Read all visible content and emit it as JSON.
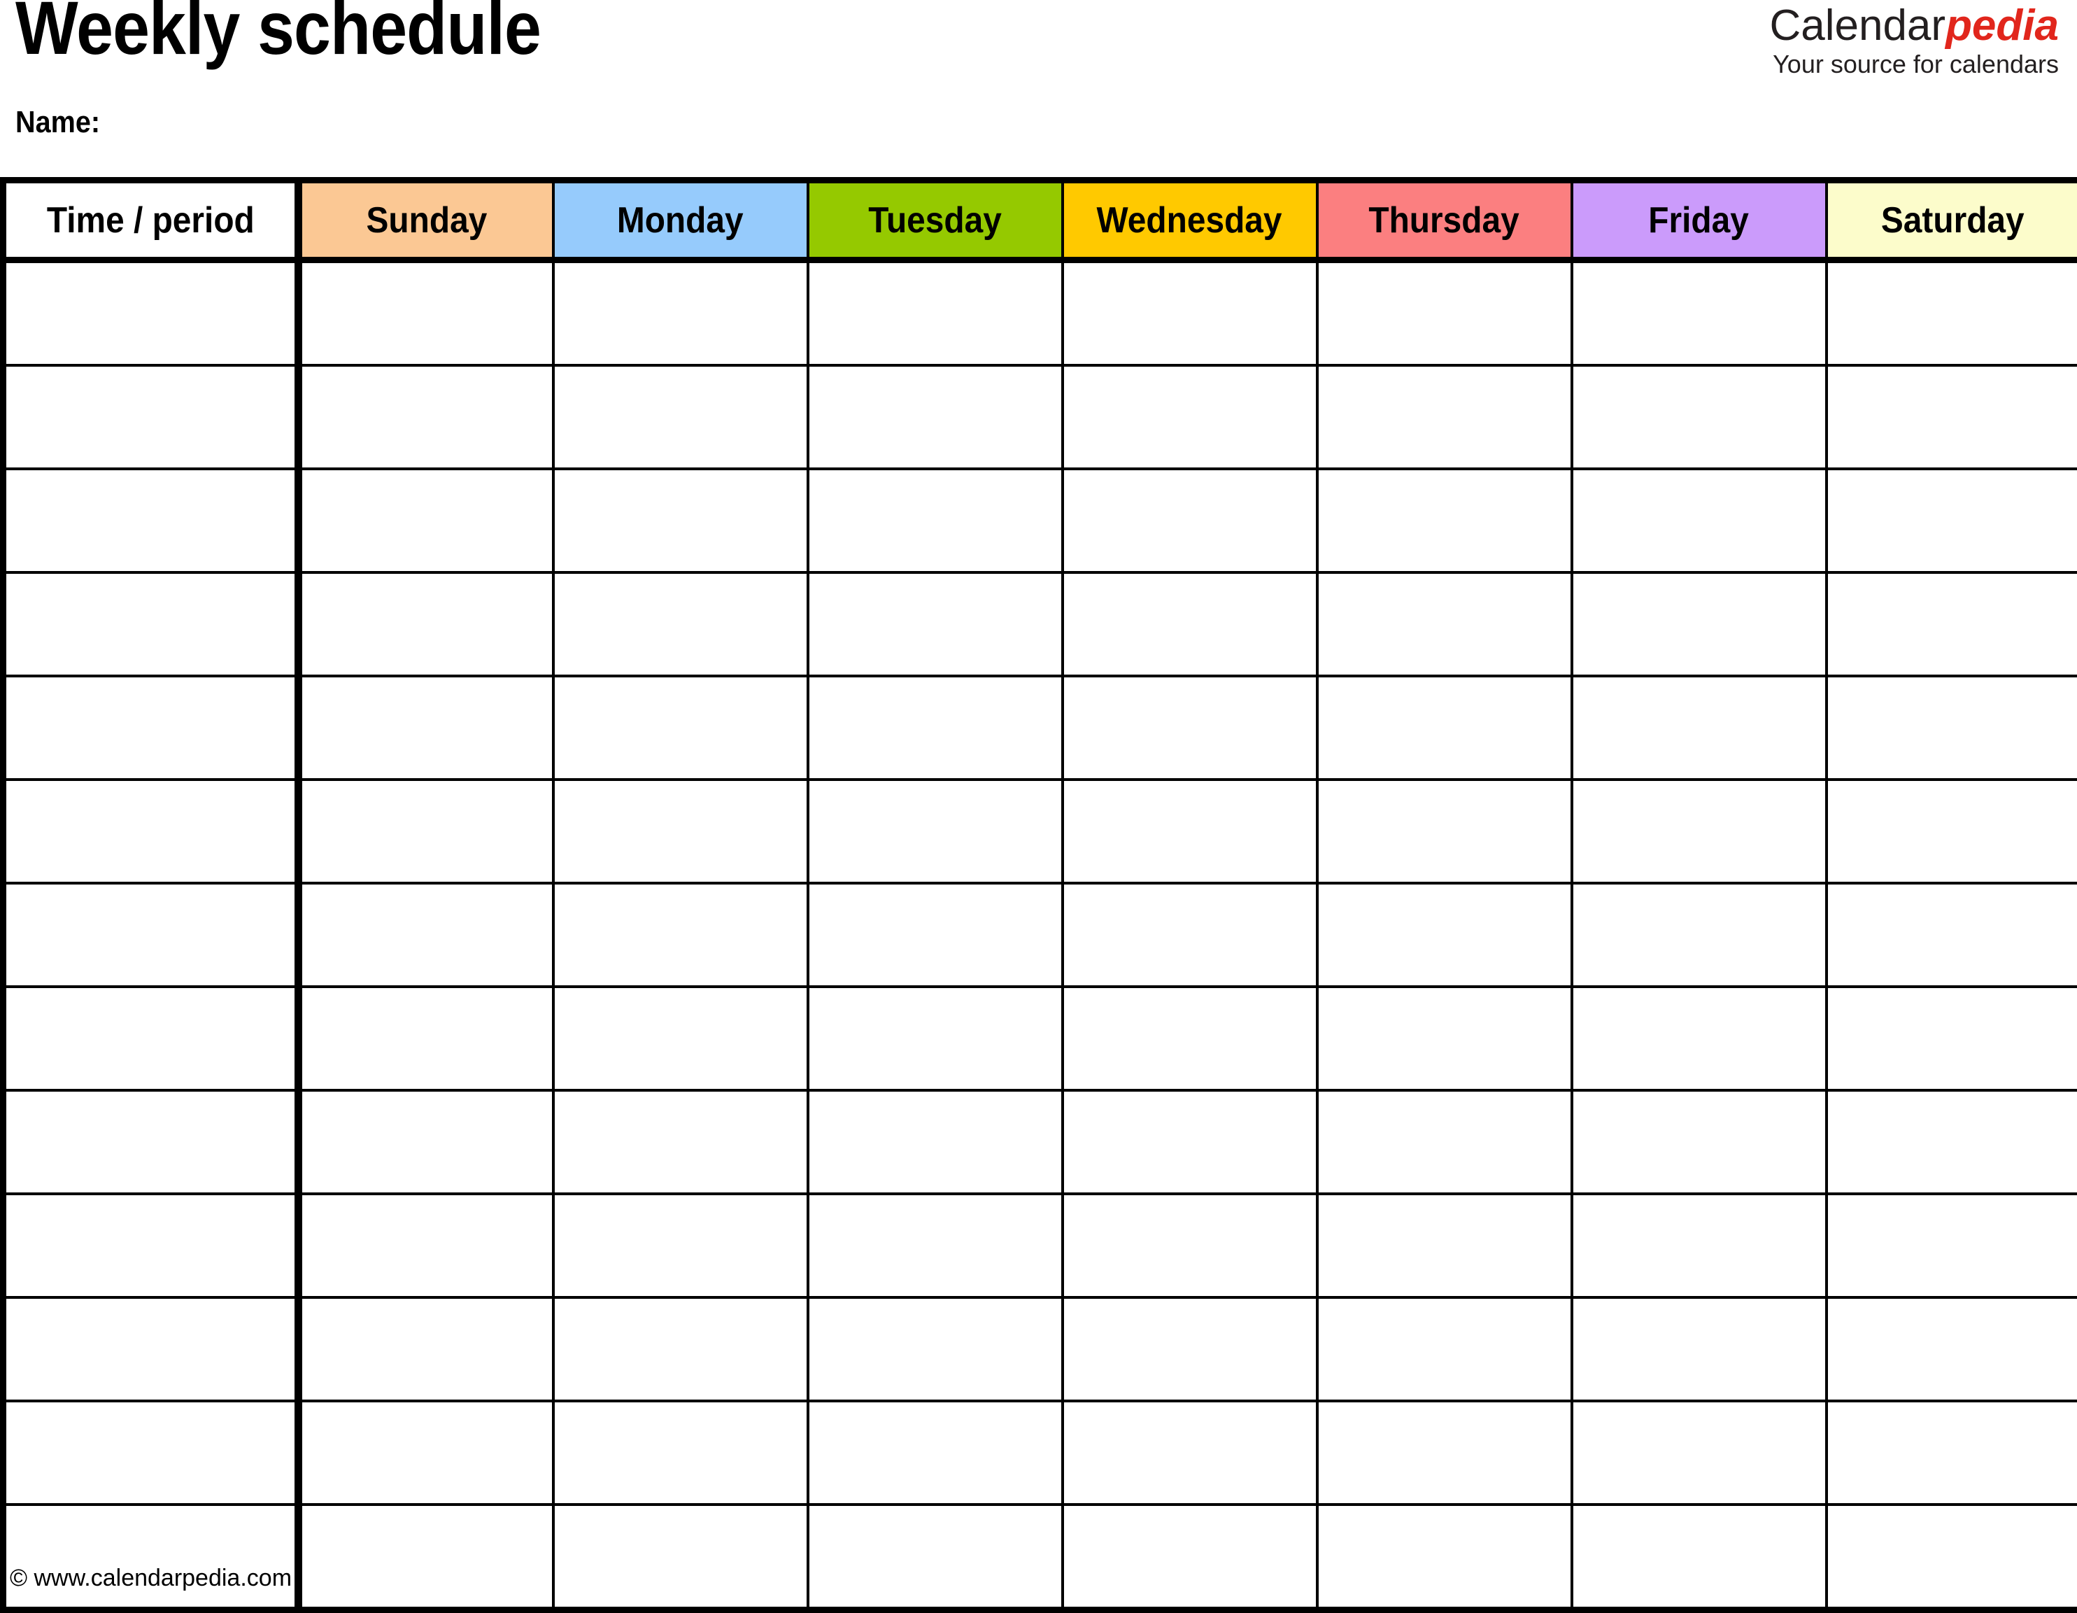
{
  "document": {
    "title": "Weekly schedule",
    "name_label": "Name:"
  },
  "brand": {
    "word_part_1": "Calendar",
    "word_part_2": "pedia",
    "tagline": "Your source for calendars",
    "accent_color": "#e1261c",
    "text_color": "#231f20"
  },
  "table": {
    "columns": [
      {
        "key": "time",
        "label": "Time / period",
        "bg": "#ffffff"
      },
      {
        "key": "sunday",
        "label": "Sunday",
        "bg": "#fbc894"
      },
      {
        "key": "monday",
        "label": "Monday",
        "bg": "#96cbfc"
      },
      {
        "key": "tuesday",
        "label": "Tuesday",
        "bg": "#95c900"
      },
      {
        "key": "wednesday",
        "label": "Wednesday",
        "bg": "#ffc900"
      },
      {
        "key": "thursday",
        "label": "Thursday",
        "bg": "#fb7f80"
      },
      {
        "key": "friday",
        "label": "Friday",
        "bg": "#cb9bfb"
      },
      {
        "key": "saturday",
        "label": "Saturday",
        "bg": "#fcfccb"
      }
    ],
    "row_count": 13,
    "rows": [
      {
        "time": "",
        "sunday": "",
        "monday": "",
        "tuesday": "",
        "wednesday": "",
        "thursday": "",
        "friday": "",
        "saturday": ""
      },
      {
        "time": "",
        "sunday": "",
        "monday": "",
        "tuesday": "",
        "wednesday": "",
        "thursday": "",
        "friday": "",
        "saturday": ""
      },
      {
        "time": "",
        "sunday": "",
        "monday": "",
        "tuesday": "",
        "wednesday": "",
        "thursday": "",
        "friday": "",
        "saturday": ""
      },
      {
        "time": "",
        "sunday": "",
        "monday": "",
        "tuesday": "",
        "wednesday": "",
        "thursday": "",
        "friday": "",
        "saturday": ""
      },
      {
        "time": "",
        "sunday": "",
        "monday": "",
        "tuesday": "",
        "wednesday": "",
        "thursday": "",
        "friday": "",
        "saturday": ""
      },
      {
        "time": "",
        "sunday": "",
        "monday": "",
        "tuesday": "",
        "wednesday": "",
        "thursday": "",
        "friday": "",
        "saturday": ""
      },
      {
        "time": "",
        "sunday": "",
        "monday": "",
        "tuesday": "",
        "wednesday": "",
        "thursday": "",
        "friday": "",
        "saturday": ""
      },
      {
        "time": "",
        "sunday": "",
        "monday": "",
        "tuesday": "",
        "wednesday": "",
        "thursday": "",
        "friday": "",
        "saturday": ""
      },
      {
        "time": "",
        "sunday": "",
        "monday": "",
        "tuesday": "",
        "wednesday": "",
        "thursday": "",
        "friday": "",
        "saturday": ""
      },
      {
        "time": "",
        "sunday": "",
        "monday": "",
        "tuesday": "",
        "wednesday": "",
        "thursday": "",
        "friday": "",
        "saturday": ""
      },
      {
        "time": "",
        "sunday": "",
        "monday": "",
        "tuesday": "",
        "wednesday": "",
        "thursday": "",
        "friday": "",
        "saturday": ""
      },
      {
        "time": "",
        "sunday": "",
        "monday": "",
        "tuesday": "",
        "wednesday": "",
        "thursday": "",
        "friday": "",
        "saturday": ""
      },
      {
        "time": "",
        "sunday": "",
        "monday": "",
        "tuesday": "",
        "wednesday": "",
        "thursday": "",
        "friday": "",
        "saturday": ""
      }
    ]
  },
  "footer": {
    "copyright": "© www.calendarpedia.com"
  }
}
